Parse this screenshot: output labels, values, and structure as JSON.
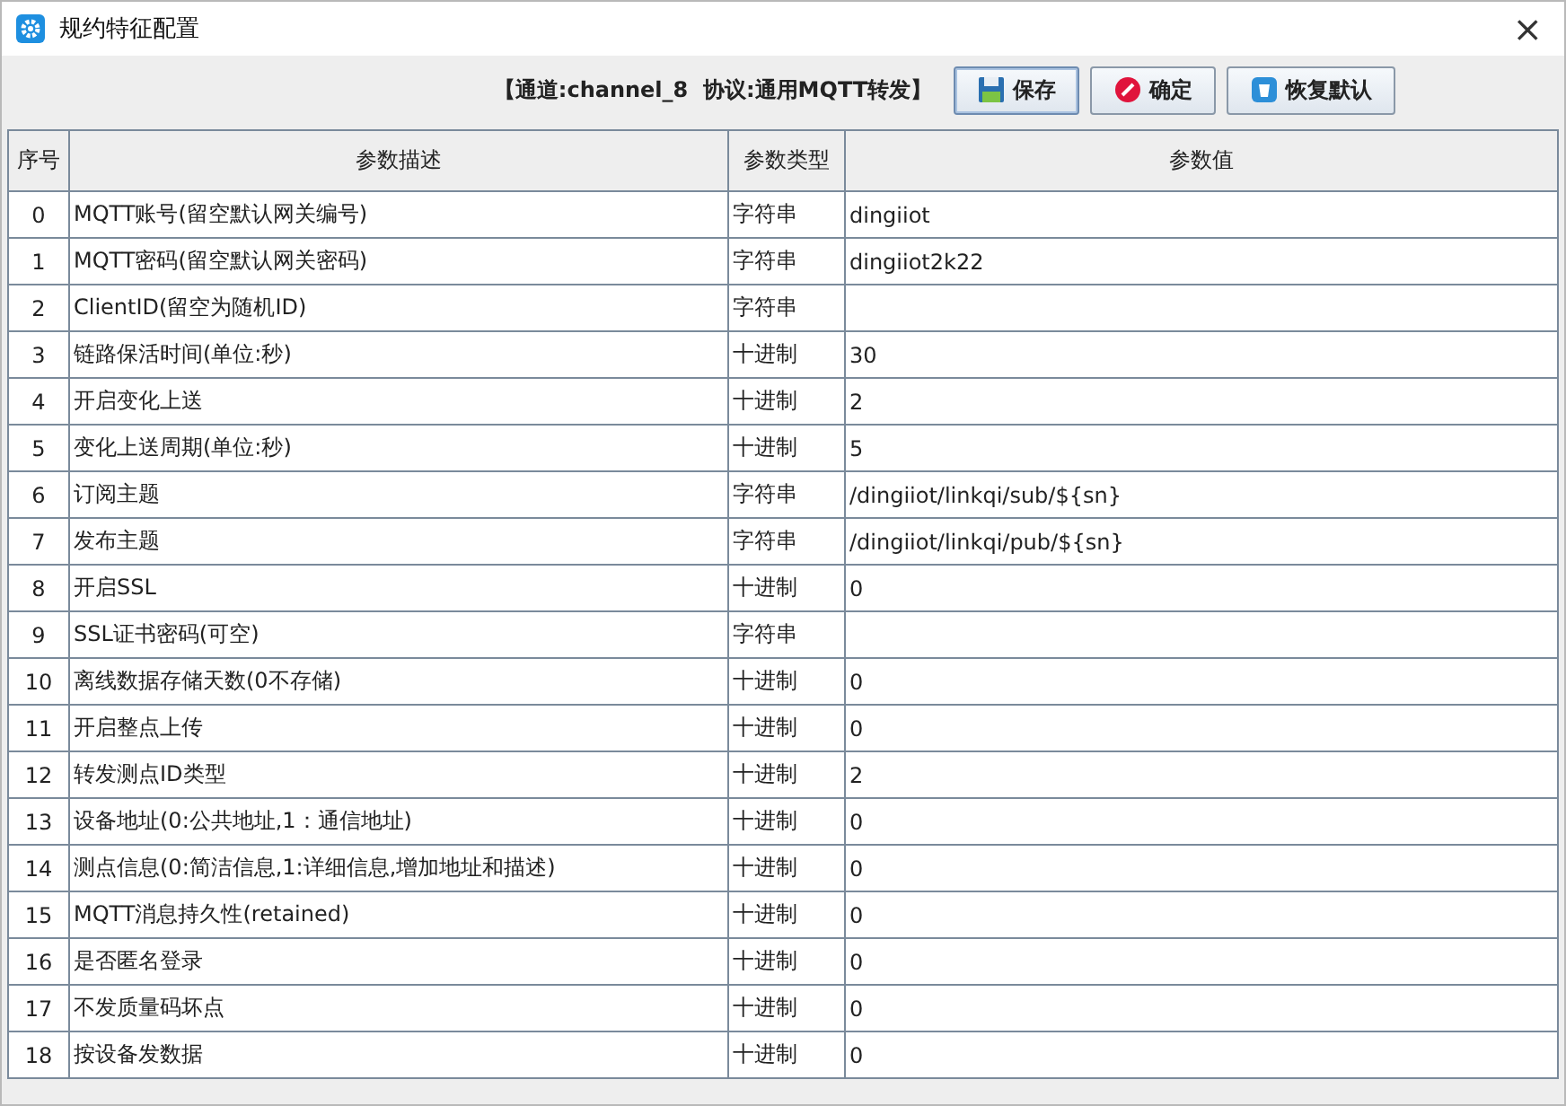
{
  "window": {
    "title": "规约特征配置",
    "close": "×"
  },
  "toolbar": {
    "caption": "【通道:channel_8  协议:通用MQTT转发】",
    "buttons": [
      {
        "label": "保存",
        "focused": true
      },
      {
        "label": "确定",
        "focused": false
      },
      {
        "label": "恢复默认",
        "focused": false
      }
    ]
  },
  "table": {
    "columns": [
      "序号",
      "参数描述",
      "参数类型",
      "参数值"
    ],
    "rows": [
      {
        "index": "0",
        "description": "MQTT账号(留空默认网关编号)",
        "type": "字符串",
        "value": "dingiiot"
      },
      {
        "index": "1",
        "description": "MQTT密码(留空默认网关密码)",
        "type": "字符串",
        "value": "dingiiot2k22"
      },
      {
        "index": "2",
        "description": "ClientID(留空为随机ID)",
        "type": "字符串"
      },
      {
        "index": "3",
        "description": "链路保活时间(单位:秒)",
        "type": "十进制",
        "value": "30"
      },
      {
        "index": "4",
        "description": "开启变化上送",
        "type": "十进制",
        "value": "2"
      },
      {
        "index": "5",
        "description": "变化上送周期(单位:秒)",
        "type": "十进制",
        "value": "5"
      },
      {
        "index": "6",
        "description": "订阅主题",
        "type": "字符串",
        "value": "/dingiiot/linkqi/sub/${sn}"
      },
      {
        "index": "7",
        "description": "发布主题",
        "type": "字符串",
        "value": "/dingiiot/linkqi/pub/${sn}"
      },
      {
        "index": "8",
        "description": "开启SSL",
        "type": "十进制",
        "value": "0"
      },
      {
        "index": "9",
        "description": "SSL证书密码(可空)",
        "type": "字符串"
      },
      {
        "index": "10",
        "description": "离线数据存储天数(0不存储)",
        "type": "十进制",
        "value": "0"
      },
      {
        "index": "11",
        "description": "开启整点上传",
        "type": "十进制",
        "value": "0"
      },
      {
        "index": "12",
        "description": "转发测点ID类型",
        "type": "十进制",
        "value": "2"
      },
      {
        "index": "13",
        "description": "设备地址(0:公共地址,1：通信地址)",
        "type": "十进制",
        "value": "0"
      },
      {
        "index": "14",
        "description": "测点信息(0:简洁信息,1:详细信息,增加地址和描述)",
        "type": "十进制",
        "value": "0"
      },
      {
        "index": "15",
        "description": "MQTT消息持久性(retained)",
        "type": "十进制",
        "value": "0"
      },
      {
        "index": "16",
        "description": "是否匿名登录",
        "type": "十进制",
        "value": "0"
      },
      {
        "index": "17",
        "description": "不发质量码坏点",
        "type": "十进制",
        "value": "0"
      },
      {
        "index": "18",
        "description": "按设备发数据",
        "type": "十进制",
        "value": "0"
      }
    ]
  }
}
